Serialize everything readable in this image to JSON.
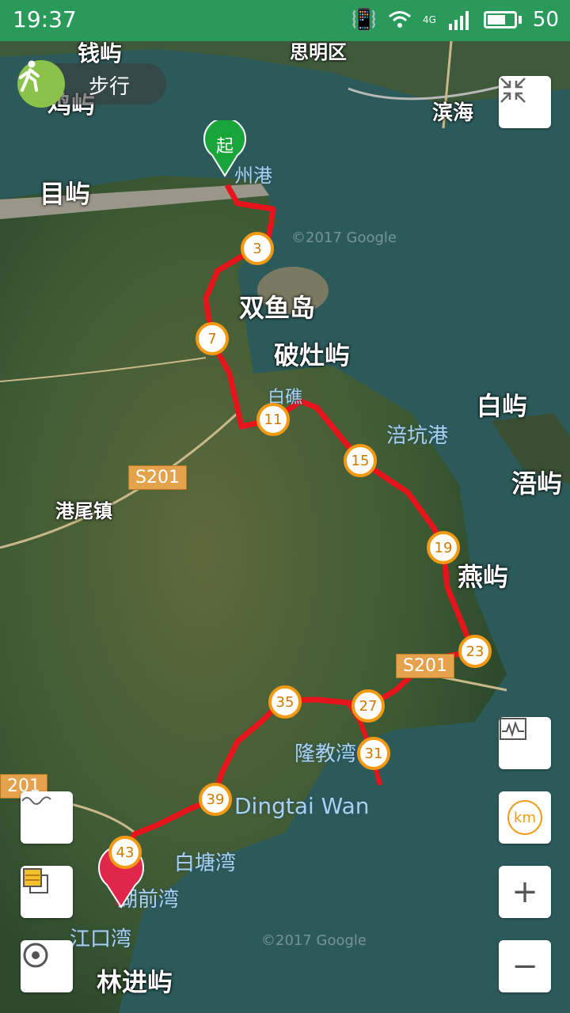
{
  "status_bar": {
    "time": "19:37",
    "network": "4G",
    "battery": "50",
    "icons": [
      "vibrate-icon",
      "wifi-icon",
      "signal-icon",
      "battery-icon"
    ]
  },
  "mode": {
    "label": "步行",
    "icon": "walking-person-icon",
    "color": "#8bc34a"
  },
  "map": {
    "route_color": "#e8141c",
    "marker_color": "#f39a12",
    "start_pin_label": "起",
    "start_pin_color": "#1aa53a",
    "end_pin_color": "#e0264a",
    "watermark": "©2017 Google",
    "labels": {
      "l1": "钱屿",
      "l2": "思明区",
      "l3": "鸡屿",
      "l4": "滨海",
      "l5": "目屿",
      "l6": "州港",
      "l7": "双鱼岛",
      "l8": "破灶屿",
      "l9": "白屿",
      "l10": "涪坑港",
      "l11": "白礁",
      "l12": "浯屿",
      "l13": "港尾镇",
      "l14": "燕屿",
      "l15": "隆教湾",
      "l16": "Dingtai Wan",
      "l17": "白塘湾",
      "l18": "湖前湾",
      "l19": "江口湾",
      "l20": "林进屿"
    },
    "roads": [
      "S201",
      "S201",
      "201"
    ],
    "km_markers": [
      "3",
      "7",
      "11",
      "15",
      "19",
      "23",
      "27",
      "31",
      "35",
      "39",
      "43"
    ]
  },
  "controls": {
    "collapse": "collapse-arrows-icon",
    "elevation": "elevation-chart-icon",
    "km_toggle": "km",
    "zoom_in": "+",
    "zoom_out": "−",
    "route_style": "wave-line-icon",
    "layers": "layers-icon",
    "locate": "locate-icon"
  }
}
